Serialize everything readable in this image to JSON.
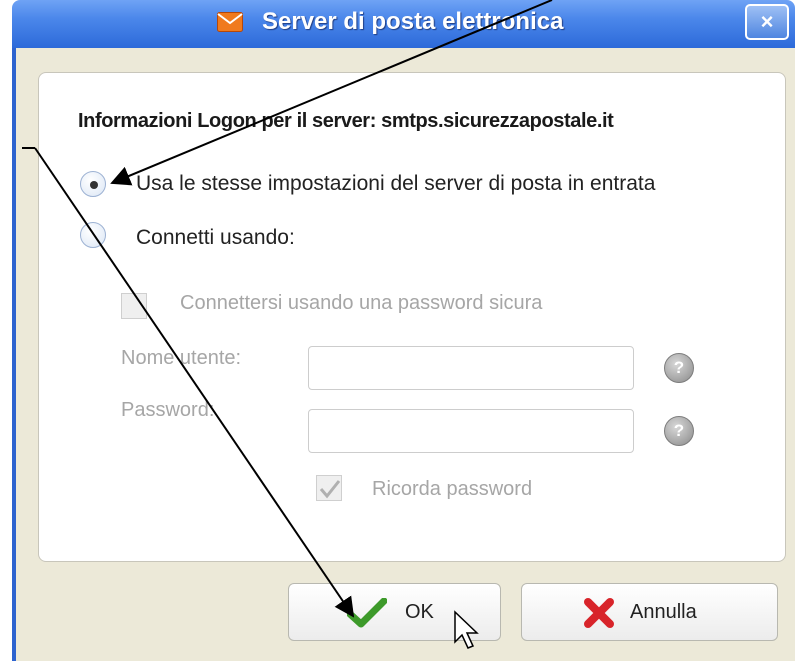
{
  "window": {
    "title": "Server di posta elettronica",
    "close_label": "×"
  },
  "content": {
    "heading": "Informazioni Logon per il server: smtps.sicurezzapostale.it",
    "radio_same": "Usa le stesse impostazioni del server di posta in entrata",
    "radio_connect": "Connetti usando:",
    "spa_checkbox": "Connettersi usando una password sicura",
    "username_label": "Nome utente:",
    "username_value": "",
    "password_label": "Password:",
    "password_value": "",
    "remember_checkbox": "Ricorda password",
    "help_glyph": "?"
  },
  "buttons": {
    "ok": "OK",
    "cancel": "Annulla"
  },
  "colors": {
    "title_bar": "#2d6ad9",
    "ok_check": "#3d9a2a",
    "cancel_x": "#d8242a"
  }
}
